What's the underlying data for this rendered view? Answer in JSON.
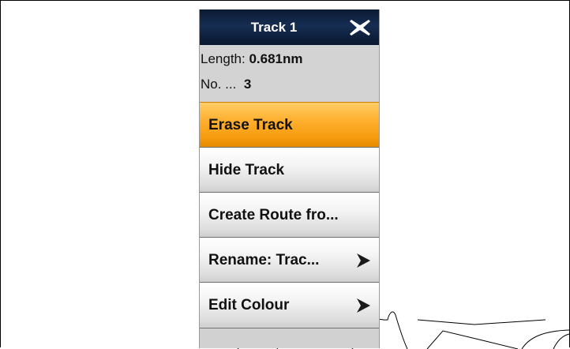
{
  "panel": {
    "title": "Track 1",
    "info": {
      "length_label": "Length:",
      "length_value": "0.681nm",
      "count_label": "No. ...",
      "count_value": "3"
    },
    "menu": [
      {
        "label": "Erase Track",
        "active": true,
        "has_submenu": false
      },
      {
        "label": "Hide Track",
        "active": false,
        "has_submenu": false
      },
      {
        "label": "Create Route fro...",
        "active": false,
        "has_submenu": false
      },
      {
        "label": "Rename: Trac...",
        "active": false,
        "has_submenu": true
      },
      {
        "label": "Edit Colour",
        "active": false,
        "has_submenu": true
      }
    ]
  },
  "icons": {
    "close": "close-x-icon",
    "submenu": "chevron-right-icon"
  },
  "colors": {
    "header_bg": "#0b1a33",
    "active_item": "#ffb030"
  }
}
